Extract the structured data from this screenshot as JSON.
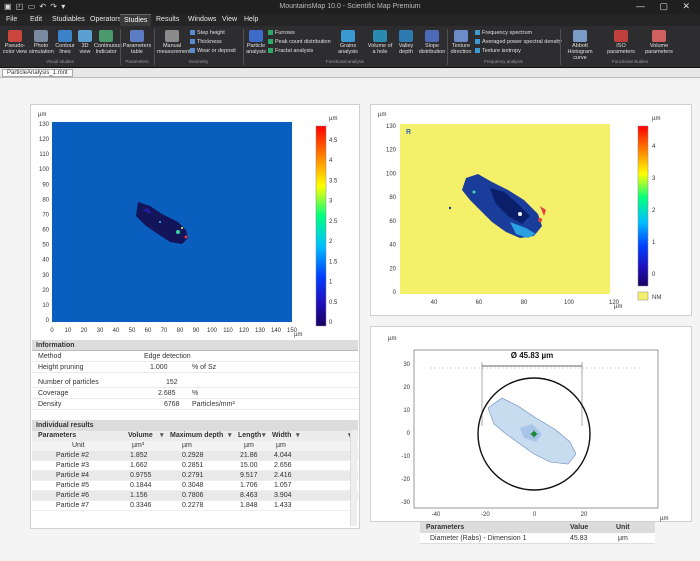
{
  "window": {
    "title": "MountainsMap 10.0 - Scientific Map Premium",
    "quick_access": "▣ ◰ ▭ ↶ ↷ ▾",
    "controls": "— ▢ ✕"
  },
  "menu": {
    "tabs": [
      "File",
      "Edit",
      "Studiables",
      "Operators",
      "Studies",
      "Results",
      "Windows",
      "View",
      "Help"
    ],
    "active": "Studies"
  },
  "ribbon": {
    "buttons": [
      {
        "label": "Pseudo-color view",
        "color": "#c8463c"
      },
      {
        "label": "Photo simulation",
        "color": "#7a8aa0"
      },
      {
        "label": "Contour lines",
        "color": "#3c82c8"
      },
      {
        "label": "3D view",
        "color": "#5aa0d0"
      },
      {
        "label": "Continuous Indicator",
        "color": "#4b9a6e"
      },
      {
        "label": "Parameters table",
        "color": "#5c7cc4"
      },
      {
        "label": "Manual measurements",
        "color": "#8a8a8a"
      },
      {
        "label": "Particle analysis",
        "color": "#3c6cc8"
      },
      {
        "label": "Grains analysis",
        "color": "#3c9ad2"
      },
      {
        "label": "Volume of a hole",
        "color": "#2c8ab0"
      },
      {
        "label": "Valley depth",
        "color": "#2c7ab0"
      },
      {
        "label": "Slope distribution",
        "color": "#4c6ab8"
      },
      {
        "label": "Texture direction",
        "color": "#6c8cc8"
      },
      {
        "label": "Abbott Histogram curve",
        "color": "#7c9cc8"
      },
      {
        "label": "ISO parameters",
        "color": "#c04040"
      },
      {
        "label": "Volume parameters",
        "color": "#d06060"
      }
    ],
    "small": [
      {
        "label": "Step height",
        "color": "#5a8ad0"
      },
      {
        "label": "Thickness",
        "color": "#5a8ad0"
      },
      {
        "label": "Wear or deposit",
        "color": "#5a8ad0"
      },
      {
        "label": "Furrows",
        "color": "#2fa86a"
      },
      {
        "label": "Peak count distribution",
        "color": "#2fa86a"
      },
      {
        "label": "Fractal analysis",
        "color": "#2fa86a"
      },
      {
        "label": "Frequency spectrum",
        "color": "#3c9ad2"
      },
      {
        "label": "Averaged power spectral density",
        "color": "#3c9ad2"
      },
      {
        "label": "Texture isotropy",
        "color": "#3c9ad2"
      }
    ],
    "groups": [
      "Visual studies",
      "Parameters",
      "Geometry",
      "Functional analysis",
      "Frequency analysis",
      "Functional studies"
    ]
  },
  "document": {
    "tab": "ParticleAnalysis_1.mnt"
  },
  "colorbar_left": {
    "unit": "µm",
    "ticks": [
      "4.5",
      "4",
      "3.5",
      "3",
      "2.5",
      "2",
      "1.5",
      "1",
      "0.5",
      "0"
    ],
    "colors": [
      "#ff0000",
      "#ff8000",
      "#ffff00",
      "#00ff80",
      "#00c0ff",
      "#0040ff",
      "#2010c0",
      "#180060"
    ]
  },
  "map_left": {
    "y_unit": "µm",
    "x_unit": "µm",
    "y_ticks": [
      "130",
      "120",
      "110",
      "100",
      "90",
      "80",
      "70",
      "60",
      "50",
      "40",
      "30",
      "20",
      "10",
      "0"
    ],
    "x_ticks": [
      "0",
      "10",
      "20",
      "30",
      "40",
      "50",
      "60",
      "70",
      "80",
      "90",
      "100",
      "110",
      "120",
      "130",
      "140",
      "150"
    ],
    "background": "#0a5fbe",
    "particle_color": "#14145a"
  },
  "map_right": {
    "y_unit": "µm",
    "x_unit": "µm",
    "y_ticks": [
      "130",
      "120",
      "100",
      "80",
      "60",
      "40",
      "20",
      "0"
    ],
    "x_ticks": [
      "40",
      "60",
      "80",
      "100",
      "120"
    ],
    "background": "#f5f06a",
    "particle_color": "#1a3c9a",
    "corner_label": "R"
  },
  "colorbar_right": {
    "unit": "µm",
    "ticks": [
      "4",
      "3",
      "2",
      "1",
      "0"
    ],
    "colors": [
      "#ff0000",
      "#ff8000",
      "#ffff00",
      "#00ff80",
      "#00c0ff",
      "#0040ff",
      "#2010c0",
      "#180060"
    ],
    "nm_label": "NM",
    "nm_color": "#f5f06a"
  },
  "zoom": {
    "unit_y": "µm",
    "unit_x": "µm",
    "y_ticks": [
      "30",
      "20",
      "10",
      "0",
      "-10",
      "-20",
      "-30"
    ],
    "x_ticks": [
      "-40",
      "-20",
      "0",
      "20"
    ],
    "diameter_label": "Ø 45.83 µm",
    "particle_color": "#c8dcf0",
    "accent": "#1a8a3a"
  },
  "information": {
    "title": "Information",
    "rows": [
      {
        "name": "Method",
        "value": "Edge detection",
        "unit": ""
      },
      {
        "name": "Height pruning",
        "value": "1.000",
        "unit": "% of Sz"
      },
      {
        "name": "Number of particles",
        "value": "152",
        "unit": ""
      },
      {
        "name": "Coverage",
        "value": "2.685",
        "unit": "%"
      },
      {
        "name": "Density",
        "value": "6768",
        "unit": "Particles/mm²"
      }
    ]
  },
  "results": {
    "title": "Individual results",
    "columns": [
      "Parameters",
      "Volume",
      "Maximum depth",
      "Length",
      "Width"
    ],
    "units": [
      "Unit",
      "µm³",
      "µm",
      "µm",
      "µm"
    ],
    "rows": [
      [
        "Particle #2",
        "1.852",
        "0.2928",
        "21.86",
        "4.044"
      ],
      [
        "Particle #3",
        "1.662",
        "0.2851",
        "15.00",
        "2.656"
      ],
      [
        "Particle #4",
        "0.9755",
        "0.2791",
        "9.517",
        "2.416"
      ],
      [
        "Particle #5",
        "0.1844",
        "0.3048",
        "1.706",
        "1.057"
      ],
      [
        "Particle #6",
        "1.156",
        "0.7806",
        "8.463",
        "3.904"
      ],
      [
        "Particle #7",
        "0.3346",
        "0.2278",
        "1.848",
        "1.433"
      ]
    ]
  },
  "right_table": {
    "headers": [
      "Parameters",
      "Value",
      "Unit"
    ],
    "rows": [
      [
        "Diameter (Rabs) - Dimension 1",
        "45.83",
        "µm"
      ]
    ]
  }
}
